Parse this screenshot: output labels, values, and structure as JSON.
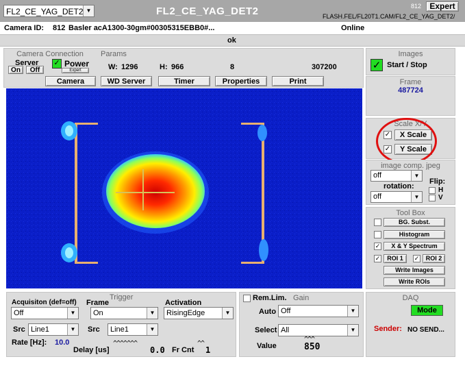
{
  "top": {
    "camera_select": "FL2_CE_YAG_DET2",
    "title": "FL2_CE_YAG_DET2",
    "number": "812",
    "expert_button": "Expert",
    "path": "FLASH.FEL/FL20T1.CAM/FL2_CE_YAG_DET2/"
  },
  "info": {
    "camera_id_label": "Camera ID:",
    "camera_id": "812",
    "camera_model": "Basler acA1300-30gm#00305315EBB0#...",
    "status": "Online",
    "message": "ok"
  },
  "connection": {
    "title": "Camera Connection",
    "server_label": "Server",
    "on": "On",
    "off": "Off",
    "power_label": "Power",
    "expert": "Expert"
  },
  "params": {
    "title": "Params",
    "w_label": "W:",
    "w": "1296",
    "h_label": "H:",
    "h": "966",
    "bits": "8",
    "pixels": "307200"
  },
  "toolbar": {
    "camera": "Camera",
    "wd_server": "WD Server",
    "timer": "Timer",
    "properties": "Properties",
    "print": "Print"
  },
  "images": {
    "title": "Images",
    "start_stop": "Start / Stop"
  },
  "frame": {
    "title": "Frame",
    "value": "487724"
  },
  "scale": {
    "title": "Scale X/Y",
    "x": "X Scale",
    "y": "Y Scale"
  },
  "image_comp": {
    "title": "image comp. jpeg",
    "value": "off",
    "rotation_label": "rotation:",
    "rotation_value": "off",
    "flip_label": "Flip:",
    "h": "H",
    "v": "V"
  },
  "toolbox": {
    "title": "Tool Box",
    "bg_subst": "BG. Subst.",
    "histogram": "Histogram",
    "spectrum": "X & Y Spectrum",
    "roi1": "ROI 1",
    "roi2": "ROI 2",
    "write_images": "Write Images",
    "write_rois": "Write ROIs"
  },
  "trigger": {
    "title": "Trigger",
    "acq_label": "Acquisiton (def=off)",
    "acq_value": "Off",
    "frame_label": "Frame",
    "frame_value": "On",
    "activation_label": "Activation",
    "activation_value": "RisingEdge",
    "src_label": "Src",
    "src1": "Line1",
    "src2_label": "Src",
    "src2": "Line1",
    "rate_label": "Rate [Hz]:",
    "rate": "10.0",
    "delay_label": "Delay [us]",
    "delay_carets": "^^^^^^^",
    "delay": "0.0",
    "frcnt_label": "Fr Cnt",
    "frcnt_carets": "^^",
    "frcnt": "1"
  },
  "gain": {
    "remlim": "Rem.Lim.",
    "title": "Gain",
    "auto_label": "Auto",
    "auto_value": "Off",
    "select_label": "Select",
    "select_value": "All",
    "value_label": "Value",
    "value_carets": "^^^",
    "value": "850"
  },
  "daq": {
    "title": "DAQ",
    "mode": "Mode",
    "sender_label": "Sender:",
    "sender": "NO SEND..."
  },
  "colors": {
    "background": "#dcdcdc",
    "image_bg": "#0a1ec8",
    "frame_value": "#1a1aa0",
    "green_button": "#22dd22",
    "sender_red": "#cc0000",
    "annotation_circle": "#e01010"
  }
}
